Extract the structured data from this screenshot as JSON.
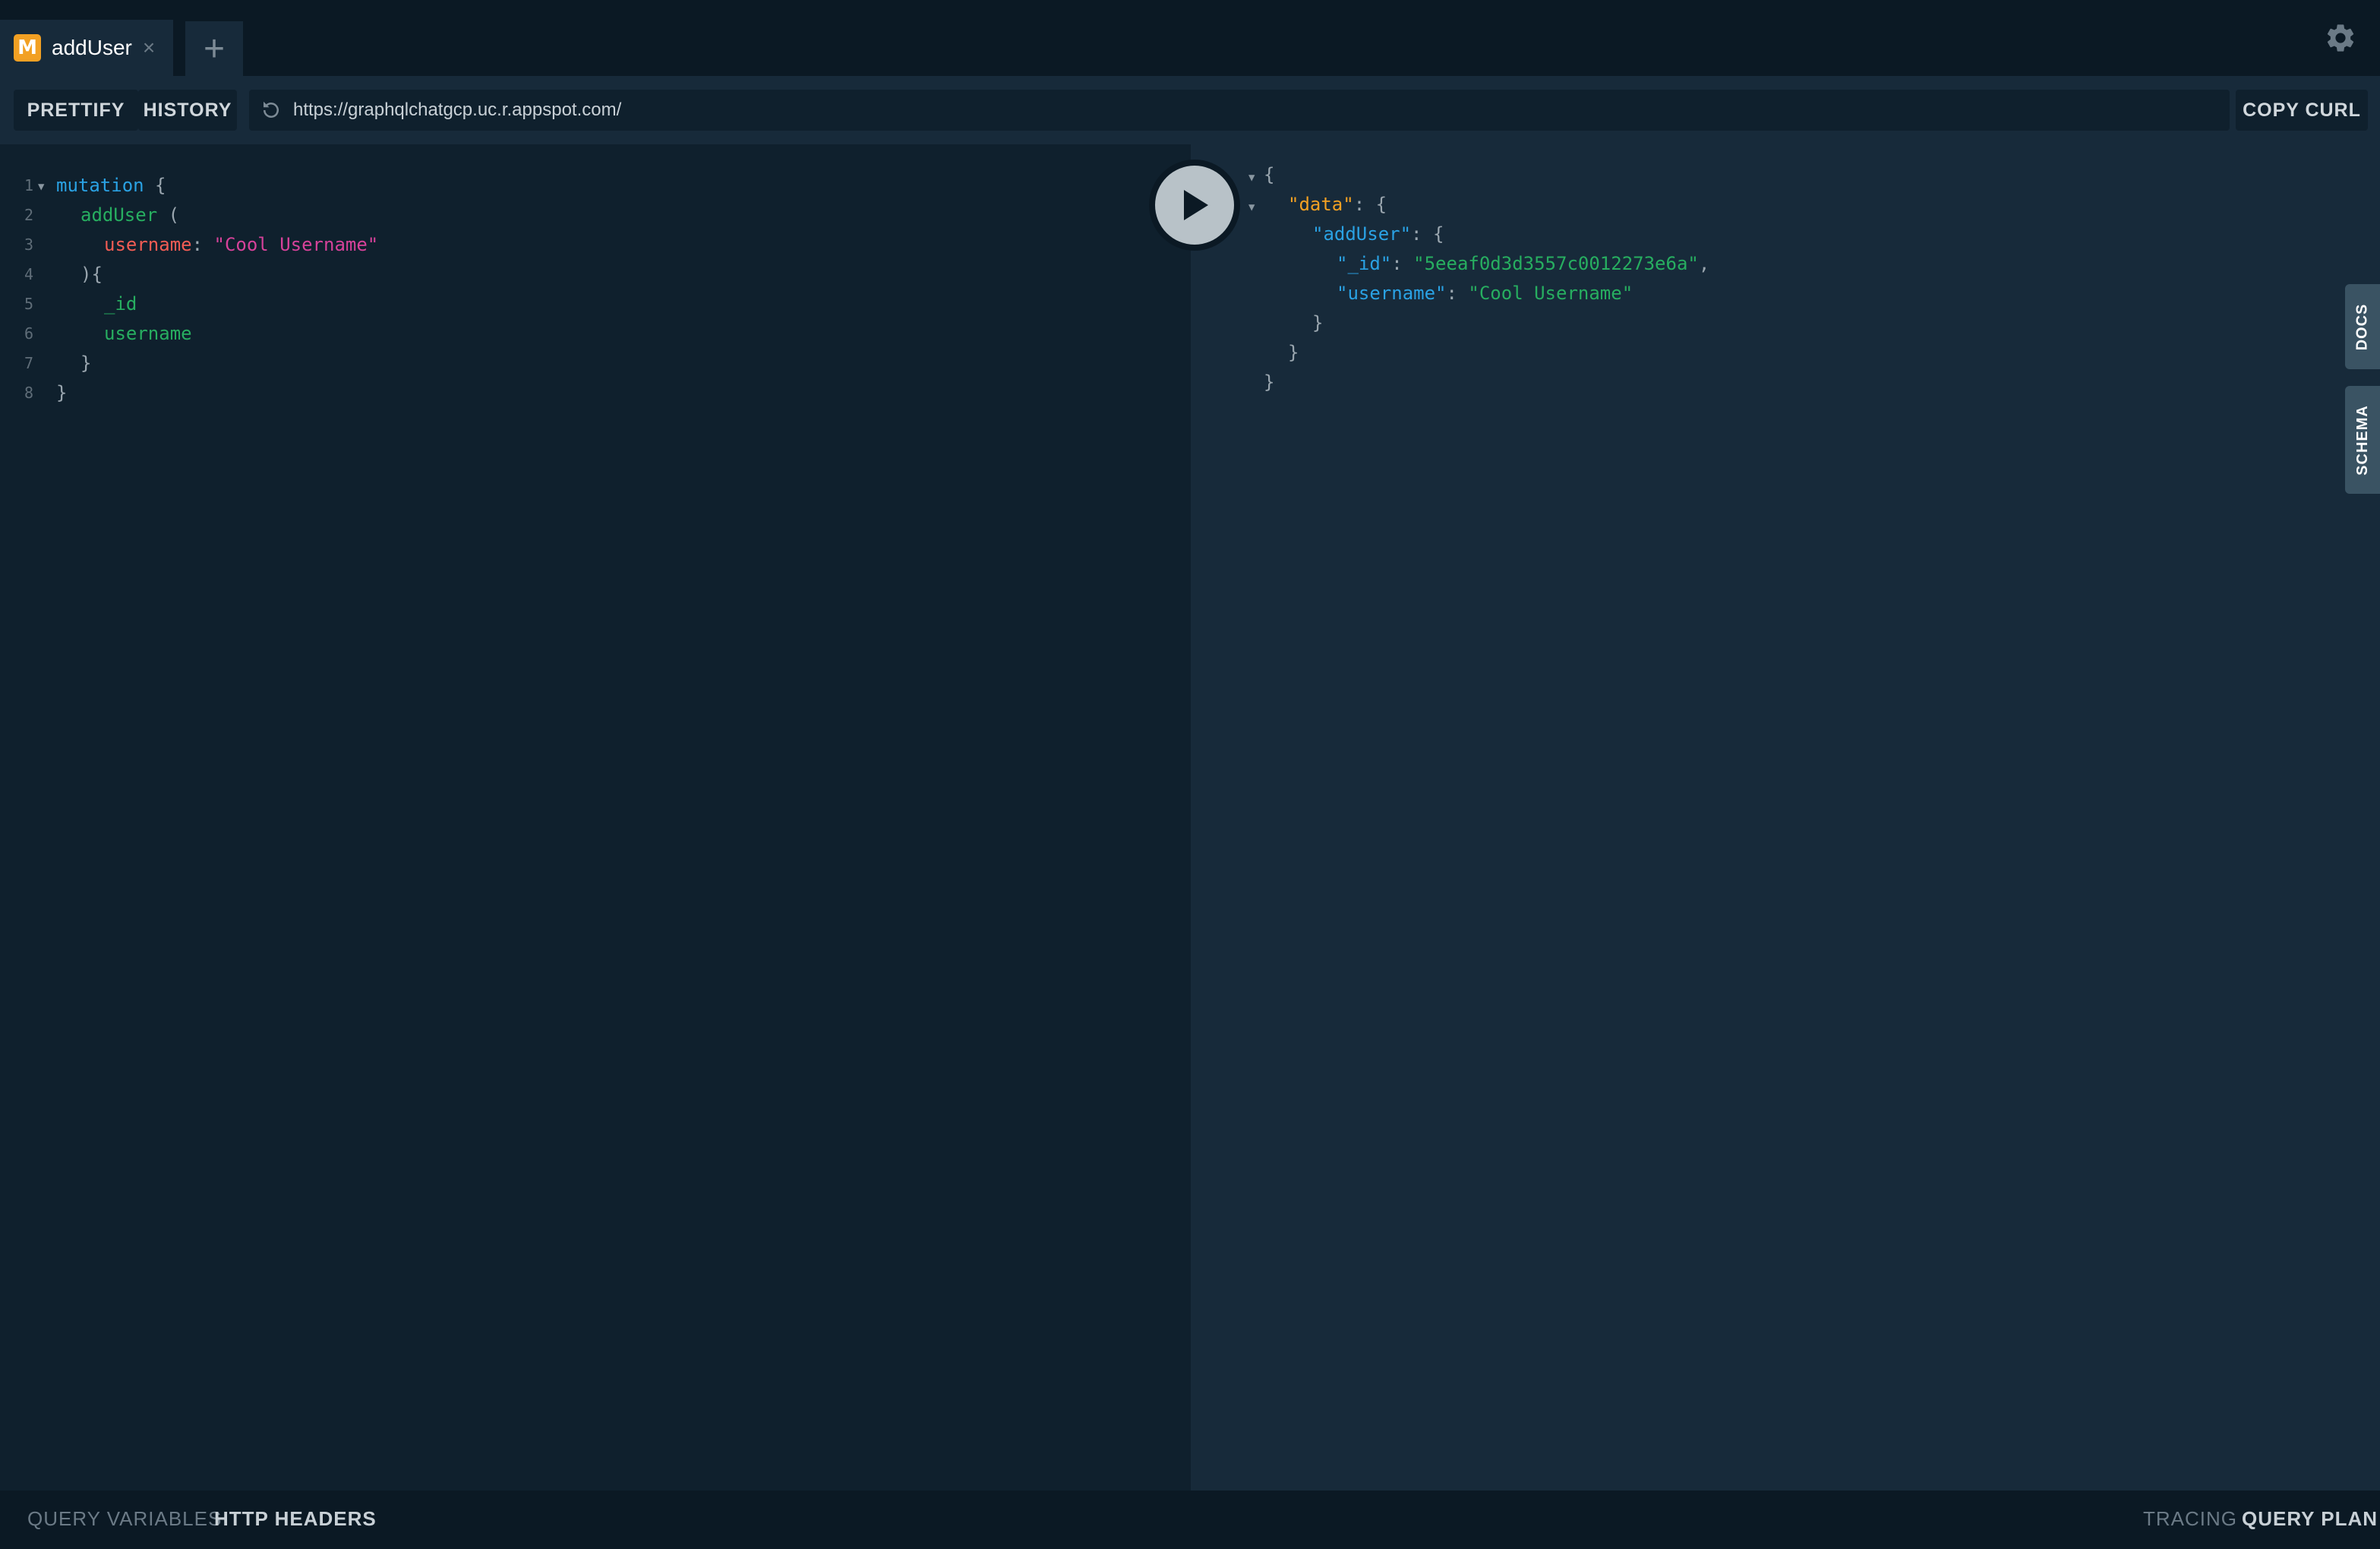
{
  "tab": {
    "badge": "M",
    "title": "addUser",
    "close_symbol": "×",
    "new_tab_symbol": "+",
    "badge_color": "#f2a023"
  },
  "toolbar": {
    "prettify": "PRETTIFY",
    "history": "HISTORY",
    "url": "https://graphqlchatgcp.uc.r.appspot.com/",
    "copy_curl": "COPY CURL"
  },
  "editor": {
    "line_numbers": [
      "1",
      "2",
      "3",
      "4",
      "5",
      "6",
      "7",
      "8"
    ],
    "lines": [
      {
        "kw": "mutation",
        "pun": " {"
      },
      {
        "fn": "addUser",
        "pun": " ("
      },
      {
        "arg": "username",
        "pun": ": ",
        "str": "\"Cool Username\""
      },
      {
        "pun": "){"
      },
      {
        "fn": "_id"
      },
      {
        "fn": "username"
      },
      {
        "pun": "}"
      },
      {
        "pun": "}"
      }
    ]
  },
  "result": {
    "open_brace": "{",
    "data_key": "\"data\"",
    "colon_brace": ": {",
    "adduser_key": "\"addUser\"",
    "id_key": "\"_id\"",
    "id_value": "\"5eeaf0d3d3557c0012273e6a\"",
    "username_key": "\"username\"",
    "username_value": "\"Cool Username\"",
    "colon": ": ",
    "comma": ",",
    "close_brace": "}"
  },
  "side_tabs": {
    "docs": "DOCS",
    "schema": "SCHEMA"
  },
  "bottom": {
    "query_variables": "QUERY VARIABLES",
    "http_headers": "HTTP HEADERS",
    "tracing": "TRACING",
    "query_plan": "QUERY PLAN"
  },
  "icons": {
    "settings": "gear-icon",
    "play": "play-icon",
    "refresh": "refresh-icon"
  }
}
